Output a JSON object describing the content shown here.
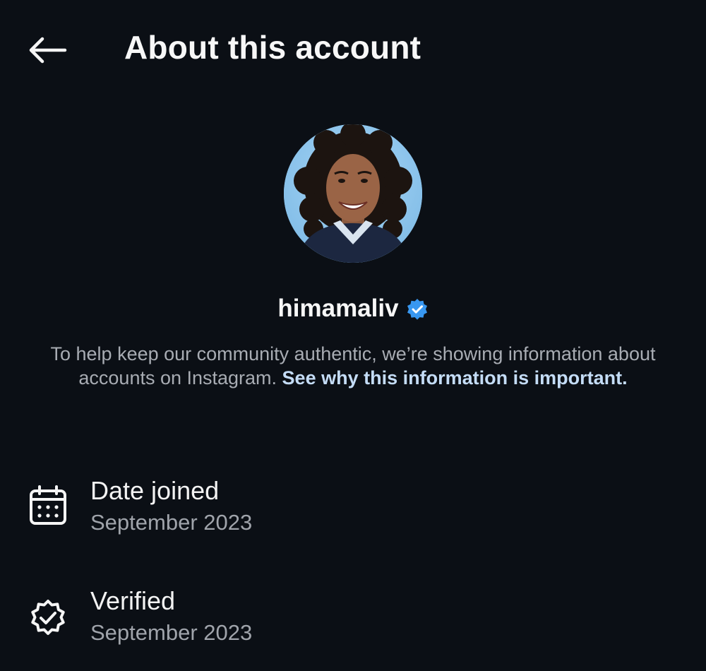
{
  "header": {
    "back_icon": "arrow-left-icon",
    "title": "About this account"
  },
  "profile": {
    "avatar": "profile-photo",
    "username": "himamaliv",
    "verified_icon": "verified-badge-icon",
    "verified_color": "#3897f0"
  },
  "info": {
    "text": "To help keep our community authentic, we’re showing information about accounts on Instagram. ",
    "link_text": "See why this information is important."
  },
  "details": [
    {
      "icon": "calendar-icon",
      "label": "Date joined",
      "value": "September 2023"
    },
    {
      "icon": "verified-seal-icon",
      "label": "Verified",
      "value": "September 2023"
    }
  ],
  "colors": {
    "background": "#0b0f15",
    "text_primary": "#f5f5f5",
    "text_secondary": "#a8acb3",
    "link": "#c4dcf6"
  }
}
